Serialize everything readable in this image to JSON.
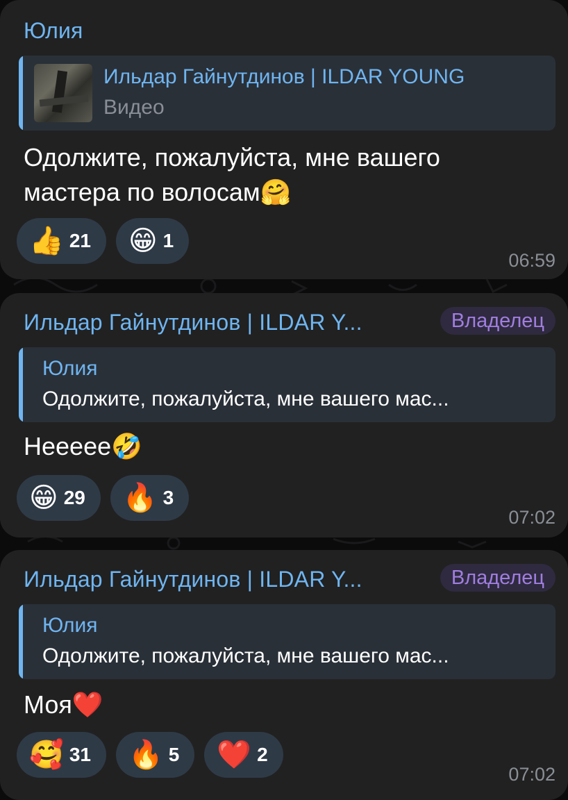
{
  "messages": [
    {
      "sender": "Юлия",
      "reply": {
        "name": "Ильдар Гайнутдинов | ILDAR YOUNG",
        "text": "Видео"
      },
      "text": "Одолжите, пожалуйста, мне вашего мастера по волосам🤗",
      "reactions": [
        {
          "emoji": "👍",
          "count": "21"
        },
        {
          "emoji": "😁",
          "count": "1"
        }
      ],
      "time": "06:59"
    },
    {
      "sender": "Ильдар Гайнутдинов | ILDAR Y...",
      "badge": "Владелец",
      "reply": {
        "name": "Юлия",
        "text": "Одолжите, пожалуйста, мне вашего мас..."
      },
      "text": "Неееее🤣",
      "reactions": [
        {
          "emoji": "😁",
          "count": "29"
        },
        {
          "emoji": "🔥",
          "count": "3"
        }
      ],
      "time": "07:02"
    },
    {
      "sender": "Ильдар Гайнутдинов | ILDAR Y...",
      "badge": "Владелец",
      "reply": {
        "name": "Юлия",
        "text": "Одолжите, пожалуйста, мне вашего мас..."
      },
      "text": "Моя❤️",
      "reactions": [
        {
          "emoji": "🥰",
          "count": "31"
        },
        {
          "emoji": "🔥",
          "count": "5"
        },
        {
          "emoji": "❤️",
          "count": "2"
        }
      ],
      "time": "07:02"
    }
  ],
  "colors": {
    "bubble": "#212121",
    "accent": "#6fb5f1",
    "owner_badge": "#a07ee0",
    "reaction_pill": "#2f3a47"
  }
}
